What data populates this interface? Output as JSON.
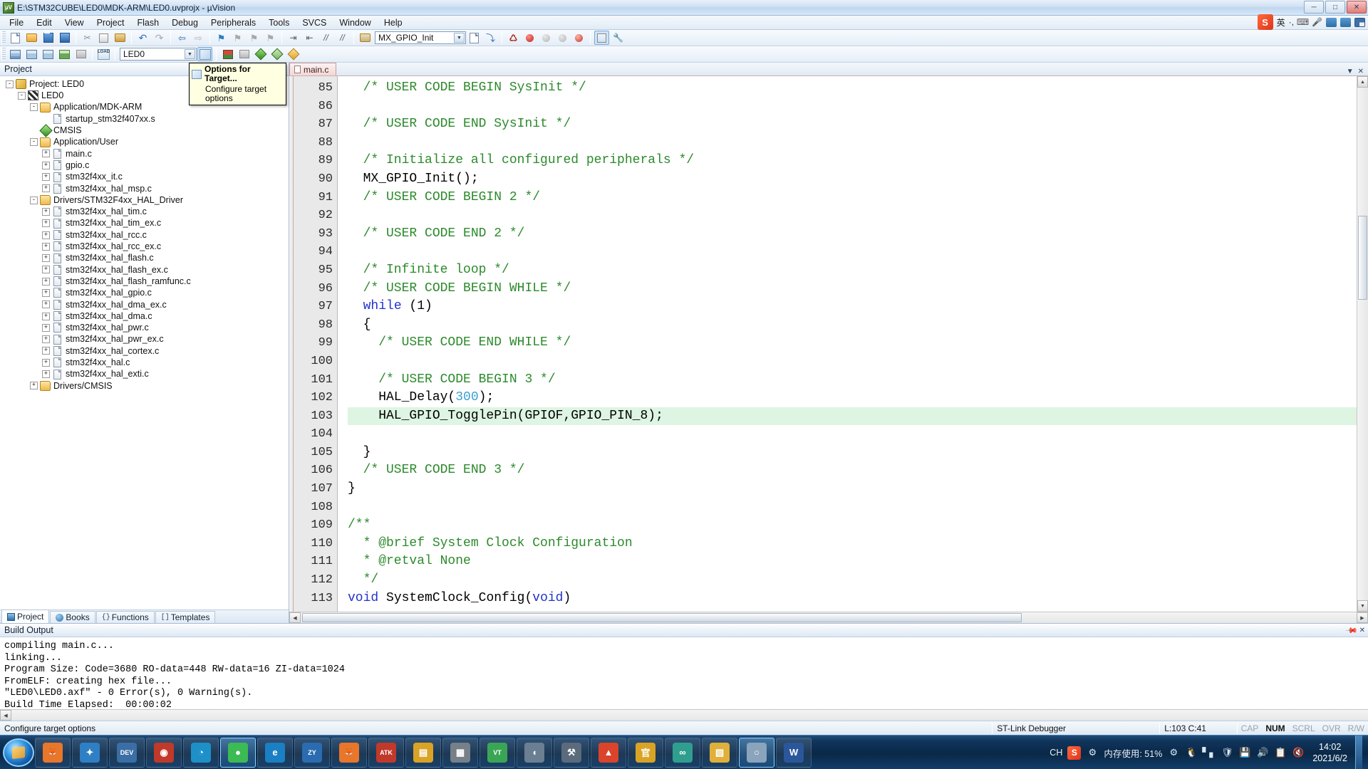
{
  "window": {
    "title": "E:\\STM32CUBE\\LED0\\MDK-ARM\\LED0.uvprojx - µVision",
    "app_icon": "uvision-icon",
    "minimize": "─",
    "maximize": "□",
    "close": "✕"
  },
  "menu": {
    "items": [
      "File",
      "Edit",
      "View",
      "Project",
      "Flash",
      "Debug",
      "Peripherals",
      "Tools",
      "SVCS",
      "Window",
      "Help"
    ]
  },
  "ime": {
    "logo": "S",
    "lang": "英",
    "dots": "·,",
    "items": [
      "keyboard-icon",
      "mic-icon",
      "panel-icon",
      "toolbox-icon",
      "grid-icon"
    ]
  },
  "toolbar_main": {
    "buttons": [
      {
        "name": "new-file-button",
        "icon": "new-file-icon"
      },
      {
        "name": "open-file-button",
        "icon": "open-folder-icon"
      },
      {
        "name": "save-button",
        "icon": "save-icon"
      },
      {
        "name": "save-all-button",
        "icon": "save-all-icon"
      },
      {
        "name": "cut-button",
        "icon": "cut-icon"
      },
      {
        "name": "copy-button",
        "icon": "copy-icon"
      },
      {
        "name": "paste-button",
        "icon": "paste-icon"
      },
      {
        "name": "undo-button",
        "icon": "undo-icon"
      },
      {
        "name": "redo-button",
        "icon": "redo-icon"
      },
      {
        "name": "back-button",
        "icon": "arrow-left-icon"
      },
      {
        "name": "forward-button",
        "icon": "arrow-right-icon"
      },
      {
        "name": "bookmark-toggle-button",
        "icon": "bookmark-icon"
      },
      {
        "name": "bookmark-prev-button",
        "icon": "bookmark-prev-icon"
      },
      {
        "name": "bookmark-next-button",
        "icon": "bookmark-next-icon"
      },
      {
        "name": "bookmark-clear-button",
        "icon": "bookmark-clear-icon"
      },
      {
        "name": "indent-button",
        "icon": "indent-icon"
      },
      {
        "name": "outdent-button",
        "icon": "outdent-icon"
      },
      {
        "name": "comment-button",
        "icon": "comment-icon"
      },
      {
        "name": "uncomment-button",
        "icon": "uncomment-icon"
      }
    ],
    "function_combo": {
      "name": "function-navigator-combo",
      "value": "MX_GPIO_Init"
    },
    "after_combo": [
      {
        "name": "find-in-files-button",
        "icon": "find-in-files-icon"
      },
      {
        "name": "goto-definition-button",
        "icon": "goto-definition-icon"
      },
      {
        "name": "debug-start-button",
        "icon": "debug-icon"
      },
      {
        "name": "breakpoint-button",
        "icon": "breakpoint-icon"
      },
      {
        "name": "breakpoint-disable-button",
        "icon": "breakpoint-disabled-icon"
      },
      {
        "name": "breakpoint-clear-button",
        "icon": "breakpoint-clear-icon"
      },
      {
        "name": "kill-breakpoints-button",
        "icon": "kill-breakpoints-icon"
      },
      {
        "name": "window-layout-button",
        "icon": "window-layout-icon"
      },
      {
        "name": "configure-button",
        "icon": "wrench-icon"
      }
    ]
  },
  "toolbar_build": {
    "buttons": [
      {
        "name": "translate-button",
        "icon": "translate-icon"
      },
      {
        "name": "build-button",
        "icon": "build-icon"
      },
      {
        "name": "rebuild-button",
        "icon": "rebuild-icon"
      },
      {
        "name": "batch-build-button",
        "icon": "batch-build-icon"
      },
      {
        "name": "stop-build-button",
        "icon": "stop-build-icon"
      },
      {
        "name": "download-button",
        "icon": "load-icon"
      }
    ],
    "target_combo": {
      "name": "target-selector-combo",
      "value": "LED0"
    },
    "after": [
      {
        "name": "target-options-button",
        "icon": "target-options-icon"
      },
      {
        "name": "manage-project-items-button",
        "icon": "manage-project-icon"
      },
      {
        "name": "multi-project-button",
        "icon": "multi-project-icon"
      },
      {
        "name": "pack-installer-button",
        "icon": "pack-installer-icon"
      },
      {
        "name": "manage-runtime-button",
        "icon": "manage-runtime-icon"
      },
      {
        "name": "svcs-button",
        "icon": "svcs-icon"
      }
    ]
  },
  "tooltip": {
    "title": "Options for Target...",
    "description": "Configure target options",
    "icon": "target-options-icon"
  },
  "project_panel": {
    "header": "Project",
    "tree": [
      {
        "label": "Project: LED0",
        "depth": 0,
        "toggle": "-",
        "icon": "project-icon"
      },
      {
        "label": "LED0",
        "depth": 1,
        "toggle": "-",
        "icon": "target-icon"
      },
      {
        "label": "Application/MDK-ARM",
        "depth": 2,
        "toggle": "-",
        "icon": "folder-icon"
      },
      {
        "label": "startup_stm32f407xx.s",
        "depth": 3,
        "toggle": "",
        "icon": "file-icon"
      },
      {
        "label": "CMSIS",
        "depth": 2,
        "toggle": "",
        "icon": "cmsis-icon"
      },
      {
        "label": "Application/User",
        "depth": 2,
        "toggle": "-",
        "icon": "folder-icon"
      },
      {
        "label": "main.c",
        "depth": 3,
        "toggle": "+",
        "icon": "file-icon"
      },
      {
        "label": "gpio.c",
        "depth": 3,
        "toggle": "+",
        "icon": "file-icon"
      },
      {
        "label": "stm32f4xx_it.c",
        "depth": 3,
        "toggle": "+",
        "icon": "file-icon"
      },
      {
        "label": "stm32f4xx_hal_msp.c",
        "depth": 3,
        "toggle": "+",
        "icon": "file-icon"
      },
      {
        "label": "Drivers/STM32F4xx_HAL_Driver",
        "depth": 2,
        "toggle": "-",
        "icon": "folder-icon"
      },
      {
        "label": "stm32f4xx_hal_tim.c",
        "depth": 3,
        "toggle": "+",
        "icon": "file-icon"
      },
      {
        "label": "stm32f4xx_hal_tim_ex.c",
        "depth": 3,
        "toggle": "+",
        "icon": "file-icon"
      },
      {
        "label": "stm32f4xx_hal_rcc.c",
        "depth": 3,
        "toggle": "+",
        "icon": "file-icon"
      },
      {
        "label": "stm32f4xx_hal_rcc_ex.c",
        "depth": 3,
        "toggle": "+",
        "icon": "file-icon"
      },
      {
        "label": "stm32f4xx_hal_flash.c",
        "depth": 3,
        "toggle": "+",
        "icon": "file-icon"
      },
      {
        "label": "stm32f4xx_hal_flash_ex.c",
        "depth": 3,
        "toggle": "+",
        "icon": "file-icon"
      },
      {
        "label": "stm32f4xx_hal_flash_ramfunc.c",
        "depth": 3,
        "toggle": "+",
        "icon": "file-icon"
      },
      {
        "label": "stm32f4xx_hal_gpio.c",
        "depth": 3,
        "toggle": "+",
        "icon": "file-icon"
      },
      {
        "label": "stm32f4xx_hal_dma_ex.c",
        "depth": 3,
        "toggle": "+",
        "icon": "file-icon"
      },
      {
        "label": "stm32f4xx_hal_dma.c",
        "depth": 3,
        "toggle": "+",
        "icon": "file-icon"
      },
      {
        "label": "stm32f4xx_hal_pwr.c",
        "depth": 3,
        "toggle": "+",
        "icon": "file-icon"
      },
      {
        "label": "stm32f4xx_hal_pwr_ex.c",
        "depth": 3,
        "toggle": "+",
        "icon": "file-icon"
      },
      {
        "label": "stm32f4xx_hal_cortex.c",
        "depth": 3,
        "toggle": "+",
        "icon": "file-icon"
      },
      {
        "label": "stm32f4xx_hal.c",
        "depth": 3,
        "toggle": "+",
        "icon": "file-icon"
      },
      {
        "label": "stm32f4xx_hal_exti.c",
        "depth": 3,
        "toggle": "+",
        "icon": "file-icon"
      },
      {
        "label": "Drivers/CMSIS",
        "depth": 2,
        "toggle": "+",
        "icon": "folder-icon"
      }
    ],
    "tabs": [
      {
        "label": "Project",
        "icon": "project-tab-icon",
        "active": true
      },
      {
        "label": "Books",
        "icon": "books-tab-icon",
        "active": false
      },
      {
        "label": "Functions",
        "icon": "functions-tab-icon",
        "active": false
      },
      {
        "label": "Templates",
        "icon": "templates-tab-icon",
        "active": false
      }
    ]
  },
  "editor": {
    "tab": {
      "label": "main.c",
      "icon": "c-file-icon"
    },
    "panel_buttons": {
      "float": "▼",
      "close": "✕"
    },
    "first_line_number": 85,
    "lines": [
      {
        "n": 85,
        "text": "  /* USER CODE BEGIN SysInit */",
        "type": "comment",
        "fold": "",
        "highlight": false
      },
      {
        "n": 86,
        "text": "",
        "type": "plain",
        "fold": "",
        "highlight": false
      },
      {
        "n": 87,
        "text": "  /* USER CODE END SysInit */",
        "type": "comment",
        "fold": "",
        "highlight": false
      },
      {
        "n": 88,
        "text": "",
        "type": "plain",
        "fold": "",
        "highlight": false
      },
      {
        "n": 89,
        "text": "  /* Initialize all configured peripherals */",
        "type": "comment",
        "fold": "",
        "highlight": false
      },
      {
        "n": 90,
        "text": "  MX_GPIO_Init();",
        "type": "code",
        "fold": "",
        "highlight": false
      },
      {
        "n": 91,
        "text": "  /* USER CODE BEGIN 2 */",
        "type": "comment",
        "fold": "",
        "highlight": false
      },
      {
        "n": 92,
        "text": "",
        "type": "plain",
        "fold": "",
        "highlight": false
      },
      {
        "n": 93,
        "text": "  /* USER CODE END 2 */",
        "type": "comment",
        "fold": "",
        "highlight": false
      },
      {
        "n": 94,
        "text": "",
        "type": "plain",
        "fold": "",
        "highlight": false
      },
      {
        "n": 95,
        "text": "  /* Infinite loop */",
        "type": "comment",
        "fold": "",
        "highlight": false
      },
      {
        "n": 96,
        "text": "  /* USER CODE BEGIN WHILE */",
        "type": "comment",
        "fold": "",
        "highlight": false
      },
      {
        "n": 97,
        "text": "  while (1)",
        "type": "while",
        "fold": "",
        "highlight": false
      },
      {
        "n": 98,
        "text": "  {",
        "type": "plain",
        "fold": "-",
        "highlight": false
      },
      {
        "n": 99,
        "text": "    /* USER CODE END WHILE */",
        "type": "comment",
        "fold": "",
        "highlight": false
      },
      {
        "n": 100,
        "text": "",
        "type": "plain",
        "fold": "",
        "highlight": false
      },
      {
        "n": 101,
        "text": "    /* USER CODE BEGIN 3 */",
        "type": "comment",
        "fold": "",
        "highlight": false
      },
      {
        "n": 102,
        "text": "    HAL_Delay(300);",
        "type": "delay",
        "fold": "",
        "highlight": false
      },
      {
        "n": 103,
        "text": "    HAL_GPIO_TogglePin(GPIOF,GPIO_PIN_8);",
        "type": "code",
        "fold": "",
        "highlight": true
      },
      {
        "n": 104,
        "text": "",
        "type": "plain",
        "fold": "",
        "highlight": false
      },
      {
        "n": 105,
        "text": "  }",
        "type": "plain",
        "fold": "",
        "highlight": false
      },
      {
        "n": 106,
        "text": "  /* USER CODE END 3 */",
        "type": "comment",
        "fold": "",
        "highlight": false
      },
      {
        "n": 107,
        "text": "}",
        "type": "plain",
        "fold": "",
        "highlight": false
      },
      {
        "n": 108,
        "text": "",
        "type": "plain",
        "fold": "",
        "highlight": false
      },
      {
        "n": 109,
        "text": "/**",
        "type": "comment",
        "fold": "-",
        "highlight": false
      },
      {
        "n": 110,
        "text": "  * @brief System Clock Configuration",
        "type": "comment-brief",
        "fold": "",
        "highlight": false
      },
      {
        "n": 111,
        "text": "  * @retval None",
        "type": "comment-brief",
        "fold": "",
        "highlight": false
      },
      {
        "n": 112,
        "text": "  */",
        "type": "comment",
        "fold": "",
        "highlight": false
      },
      {
        "n": 113,
        "text": "void SystemClock_Config(void)",
        "type": "voidfn",
        "fold": "",
        "highlight": false
      }
    ]
  },
  "build_output": {
    "header": "Build Output",
    "lines": [
      "compiling main.c...",
      "linking...",
      "Program Size: Code=3680 RO-data=448 RW-data=16 ZI-data=1024",
      "FromELF: creating hex file...",
      "\"LED0\\LED0.axf\" - 0 Error(s), 0 Warning(s).",
      "Build Time Elapsed:  00:00:02"
    ]
  },
  "status_bar": {
    "message": "Configure target options",
    "debugger": "ST-Link Debugger",
    "cursor": "L:103 C:41",
    "flags": [
      {
        "label": "CAP",
        "active": false
      },
      {
        "label": "NUM",
        "active": true
      },
      {
        "label": "SCRL",
        "active": false
      },
      {
        "label": "OVR",
        "active": false
      },
      {
        "label": "R/W",
        "active": false
      }
    ]
  },
  "taskbar": {
    "start": "start-orb",
    "items": [
      {
        "name": "taskbar-item-firefox",
        "glyph": "🦊",
        "color": "#e8762b",
        "active": false
      },
      {
        "name": "taskbar-item-navicat",
        "glyph": "✦",
        "color": "#2f7fc4",
        "active": false
      },
      {
        "name": "taskbar-item-dev",
        "glyph": "DEV",
        "color": "#3a6ea5",
        "active": false
      },
      {
        "name": "taskbar-item-record",
        "glyph": "◉",
        "color": "#c0392b",
        "active": false
      },
      {
        "name": "taskbar-item-edge",
        "glyph": "◔",
        "color": "#1e90c8",
        "active": false
      },
      {
        "name": "taskbar-item-chrome",
        "glyph": "●",
        "color": "#3cba54",
        "active": true
      },
      {
        "name": "taskbar-item-ie",
        "glyph": "e",
        "color": "#1b7fc4",
        "active": false
      },
      {
        "name": "taskbar-item-zy",
        "glyph": "ZY",
        "color": "#2b6cb0",
        "active": false
      },
      {
        "name": "taskbar-item-firefox2",
        "glyph": "🦊",
        "color": "#e8762b",
        "active": false
      },
      {
        "name": "taskbar-item-atk-xcom",
        "glyph": "ATK",
        "color": "#c0392b",
        "active": false
      },
      {
        "name": "taskbar-item-explorer",
        "glyph": "▤",
        "color": "#d9a326",
        "active": false
      },
      {
        "name": "taskbar-item-calculator",
        "glyph": "▦",
        "color": "#777f88",
        "active": false
      },
      {
        "name": "taskbar-item-vt",
        "glyph": "VT",
        "color": "#3aa655",
        "active": false
      },
      {
        "name": "taskbar-item-satellite",
        "glyph": "◖",
        "color": "#6b7f92",
        "active": false
      },
      {
        "name": "taskbar-item-tool",
        "glyph": "⚒",
        "color": "#5b6b7c",
        "active": false
      },
      {
        "name": "taskbar-item-flame",
        "glyph": "▲",
        "color": "#d9442b",
        "active": false
      },
      {
        "name": "taskbar-item-isp",
        "glyph": "官",
        "color": "#d9a326",
        "active": false
      },
      {
        "name": "taskbar-item-link",
        "glyph": "∞",
        "color": "#2f9e8f",
        "active": false
      },
      {
        "name": "taskbar-item-folder",
        "glyph": "▧",
        "color": "#e0b03a",
        "active": false
      },
      {
        "name": "taskbar-item-uvision",
        "glyph": "○",
        "color": "#8aa4bc",
        "active": true
      },
      {
        "name": "taskbar-item-word",
        "glyph": "W",
        "color": "#2b579a",
        "active": false
      }
    ],
    "tray": {
      "lang": "CH",
      "sogou": "S",
      "memory": "内存使用: 51%",
      "icons": [
        "gear-icon",
        "qq-penguin-icon",
        "signal-icon",
        "shield-icon",
        "update-icon",
        "speaker-icon",
        "clipboard-icon",
        "mute-icon"
      ],
      "time": "14:02",
      "date": "2021/6/2"
    }
  }
}
